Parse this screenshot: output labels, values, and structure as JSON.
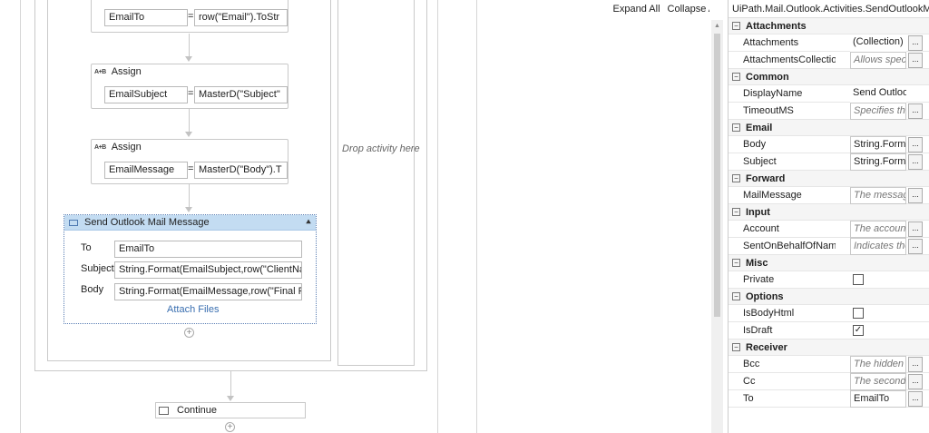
{
  "toolbar": {
    "expand_all": "Expand All",
    "collapse_all": "Collapse All"
  },
  "designer": {
    "top_assign": {
      "to": "EmailTo",
      "value": "row(\"Email\").ToStr"
    },
    "assign1": {
      "title": "Assign",
      "to": "EmailSubject",
      "eq": "=",
      "value": "MasterD(\"Subject\""
    },
    "assign2": {
      "title": "Assign",
      "to": "EmailMessage",
      "eq": "=",
      "value": "MasterD(\"Body\").T"
    },
    "assign_icon": "A+B",
    "send_mail": {
      "title": "Send Outlook Mail Message",
      "to_label": "To",
      "to_value": "EmailTo",
      "subject_label": "Subject",
      "subject_value": "String.Format(EmailSubject,row(\"ClientName",
      "body_label": "Body",
      "body_value": "String.Format(EmailMessage,row(\"Final Recip",
      "attach_files": "Attach Files"
    },
    "drop_text": "Drop activity here",
    "continue_label": "Continue"
  },
  "properties": {
    "title": "UiPath.Mail.Outlook.Activities.SendOutlookM...",
    "rows": [
      {
        "type": "cat",
        "name": "Attachments"
      },
      {
        "type": "prop",
        "name": "Attachments",
        "value": "(Collection)",
        "style": "plain",
        "btn": true
      },
      {
        "type": "prop",
        "name": "AttachmentsCollection",
        "value": "Allows speci",
        "style": "ph",
        "btn": true
      },
      {
        "type": "cat",
        "name": "Common"
      },
      {
        "type": "prop",
        "name": "DisplayName",
        "value": "Send Outlook Ma",
        "style": "plain",
        "btn": false
      },
      {
        "type": "prop",
        "name": "TimeoutMS",
        "value": "Specifies the",
        "style": "ph",
        "btn": true
      },
      {
        "type": "cat",
        "name": "Email"
      },
      {
        "type": "prop",
        "name": "Body",
        "value": "String.Forma",
        "style": "",
        "btn": true
      },
      {
        "type": "prop",
        "name": "Subject",
        "value": "String.Forma",
        "style": "",
        "btn": true
      },
      {
        "type": "cat",
        "name": "Forward"
      },
      {
        "type": "prop",
        "name": "MailMessage",
        "value": "The message",
        "style": "ph",
        "btn": true
      },
      {
        "type": "cat",
        "name": "Input"
      },
      {
        "type": "prop",
        "name": "Account",
        "value": "The account",
        "style": "ph",
        "btn": true
      },
      {
        "type": "prop",
        "name": "SentOnBehalfOfName",
        "value": "Indicates the",
        "style": "ph",
        "btn": true
      },
      {
        "type": "cat",
        "name": "Misc"
      },
      {
        "type": "check",
        "name": "Private",
        "checked": false
      },
      {
        "type": "cat",
        "name": "Options"
      },
      {
        "type": "check",
        "name": "IsBodyHtml",
        "checked": false
      },
      {
        "type": "check",
        "name": "IsDraft",
        "checked": true
      },
      {
        "type": "cat",
        "name": "Receiver"
      },
      {
        "type": "prop",
        "name": "Bcc",
        "value": "The hidden r",
        "style": "ph",
        "btn": true
      },
      {
        "type": "prop",
        "name": "Cc",
        "value": "The seconda",
        "style": "ph",
        "btn": true
      },
      {
        "type": "prop",
        "name": "To",
        "value": "EmailTo",
        "style": "",
        "btn": true
      }
    ]
  }
}
